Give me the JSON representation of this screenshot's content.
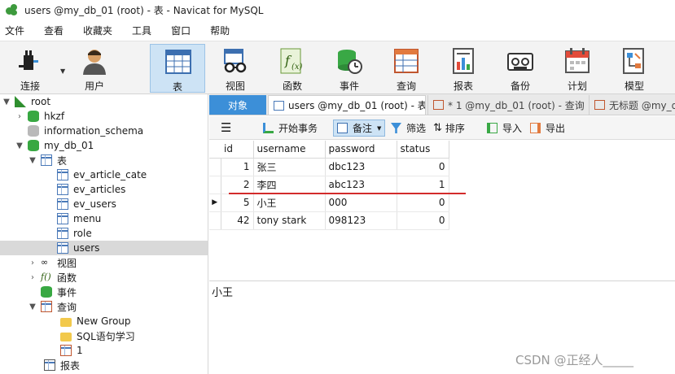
{
  "window": {
    "title": "users @my_db_01 (root) - 表 - Navicat for MySQL"
  },
  "menu": [
    "文件",
    "查看",
    "收藏夹",
    "工具",
    "窗口",
    "帮助"
  ],
  "toolbar": [
    {
      "label": "连接",
      "icon": "connection-plug-icon"
    },
    {
      "label": "用户",
      "icon": "user-icon"
    },
    {
      "label": "表",
      "icon": "table-icon",
      "active": true
    },
    {
      "label": "视图",
      "icon": "view-glasses-icon"
    },
    {
      "label": "函数",
      "icon": "function-icon"
    },
    {
      "label": "事件",
      "icon": "event-clock-icon"
    },
    {
      "label": "查询",
      "icon": "query-icon"
    },
    {
      "label": "报表",
      "icon": "report-icon"
    },
    {
      "label": "备份",
      "icon": "backup-icon"
    },
    {
      "label": "计划",
      "icon": "schedule-calendar-icon"
    },
    {
      "label": "模型",
      "icon": "model-icon"
    }
  ],
  "tree": [
    {
      "label": "root",
      "icon": "connection"
    },
    {
      "label": "hkzf",
      "icon": "db-green"
    },
    {
      "label": "information_schema",
      "icon": "db-gray"
    },
    {
      "label": "my_db_01",
      "icon": "db-green"
    },
    {
      "label": "表",
      "icon": "table"
    },
    {
      "label": "ev_article_cate",
      "icon": "table"
    },
    {
      "label": "ev_articles",
      "icon": "table"
    },
    {
      "label": "ev_users",
      "icon": "table"
    },
    {
      "label": "menu",
      "icon": "table"
    },
    {
      "label": "role",
      "icon": "table"
    },
    {
      "label": "users",
      "icon": "table",
      "selected": true
    },
    {
      "label": "视图",
      "icon": "view"
    },
    {
      "label": "函数",
      "icon": "function"
    },
    {
      "label": "事件",
      "icon": "event"
    },
    {
      "label": "查询",
      "icon": "query"
    },
    {
      "label": "New Group",
      "icon": "folder"
    },
    {
      "label": "SQL语句学习",
      "icon": "folder"
    },
    {
      "label": "1",
      "icon": "query"
    },
    {
      "label": "报表",
      "icon": "report"
    }
  ],
  "tabs": [
    {
      "label": "对象"
    },
    {
      "label": "users @my_db_01 (root) - 表"
    },
    {
      "label": "* 1 @my_db_01 (root) - 查询"
    },
    {
      "label": "无标题 @my_d"
    }
  ],
  "object_toolbar": {
    "begin_tx": "开始事务",
    "memo": "备注",
    "filter": "筛选",
    "sort": "排序",
    "import": "导入",
    "export": "导出"
  },
  "grid": {
    "columns": [
      "id",
      "username",
      "password",
      "status"
    ],
    "rows": [
      [
        "1",
        "张三",
        "dbc123",
        "0"
      ],
      [
        "2",
        "李四",
        "abc123",
        "1"
      ],
      [
        "5",
        "小王",
        "000",
        "0"
      ],
      [
        "42",
        "tony stark",
        "098123",
        "0"
      ]
    ],
    "current_row_index": 2
  },
  "detail": {
    "text": "小王"
  },
  "watermark": "CSDN @正经人_____",
  "colors": {
    "objects_tab": "#3c8fd8",
    "active_toolbar": "#cde3f5",
    "annotation_line": "#d32b2b"
  }
}
